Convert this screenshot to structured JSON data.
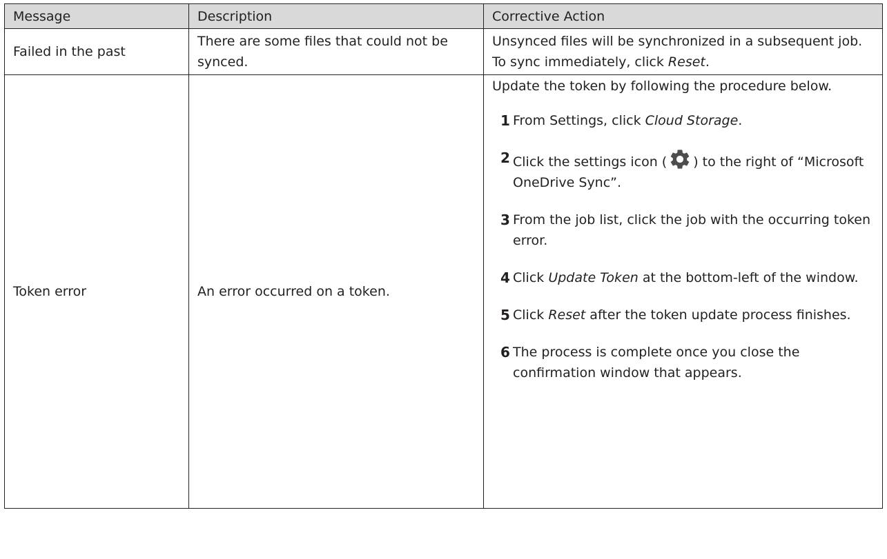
{
  "table": {
    "headers": [
      "Message",
      "Description",
      "Corrective Action"
    ],
    "rows": [
      {
        "message": "Failed in the past",
        "description": "There are some files that could not be synced.",
        "action_pre": "Unsynced files will be synchronized in a subsequent job. To sync immediately, click ",
        "action_link": "Reset",
        "action_post": "."
      },
      {
        "message": "Token error",
        "description": "An error occurred on a token.",
        "intro": "Update the token by following the procedure below.",
        "steps": [
          {
            "num": "1",
            "pre": "From Settings, click ",
            "em": "Cloud Storage",
            "post": "."
          },
          {
            "num": "2",
            "pre": "Click the settings icon (",
            "icon": "gear-icon",
            "post": ") to the right of “Microsoft OneDrive Sync”."
          },
          {
            "num": "3",
            "text": "From the job list, click the job with the occurring token error."
          },
          {
            "num": "4",
            "pre": "Click ",
            "em": "Update Token",
            "post": " at the bottom-left of the window."
          },
          {
            "num": "5",
            "pre": "Click ",
            "em": "Reset",
            "post": " after the token update process finishes."
          },
          {
            "num": "6",
            "text": "The process is complete once you close the confirmation window that appears."
          }
        ]
      }
    ]
  },
  "colors": {
    "header_bg": "#d9d9d9",
    "border": "#231f20",
    "gear_icon": "#4d4d4d"
  }
}
